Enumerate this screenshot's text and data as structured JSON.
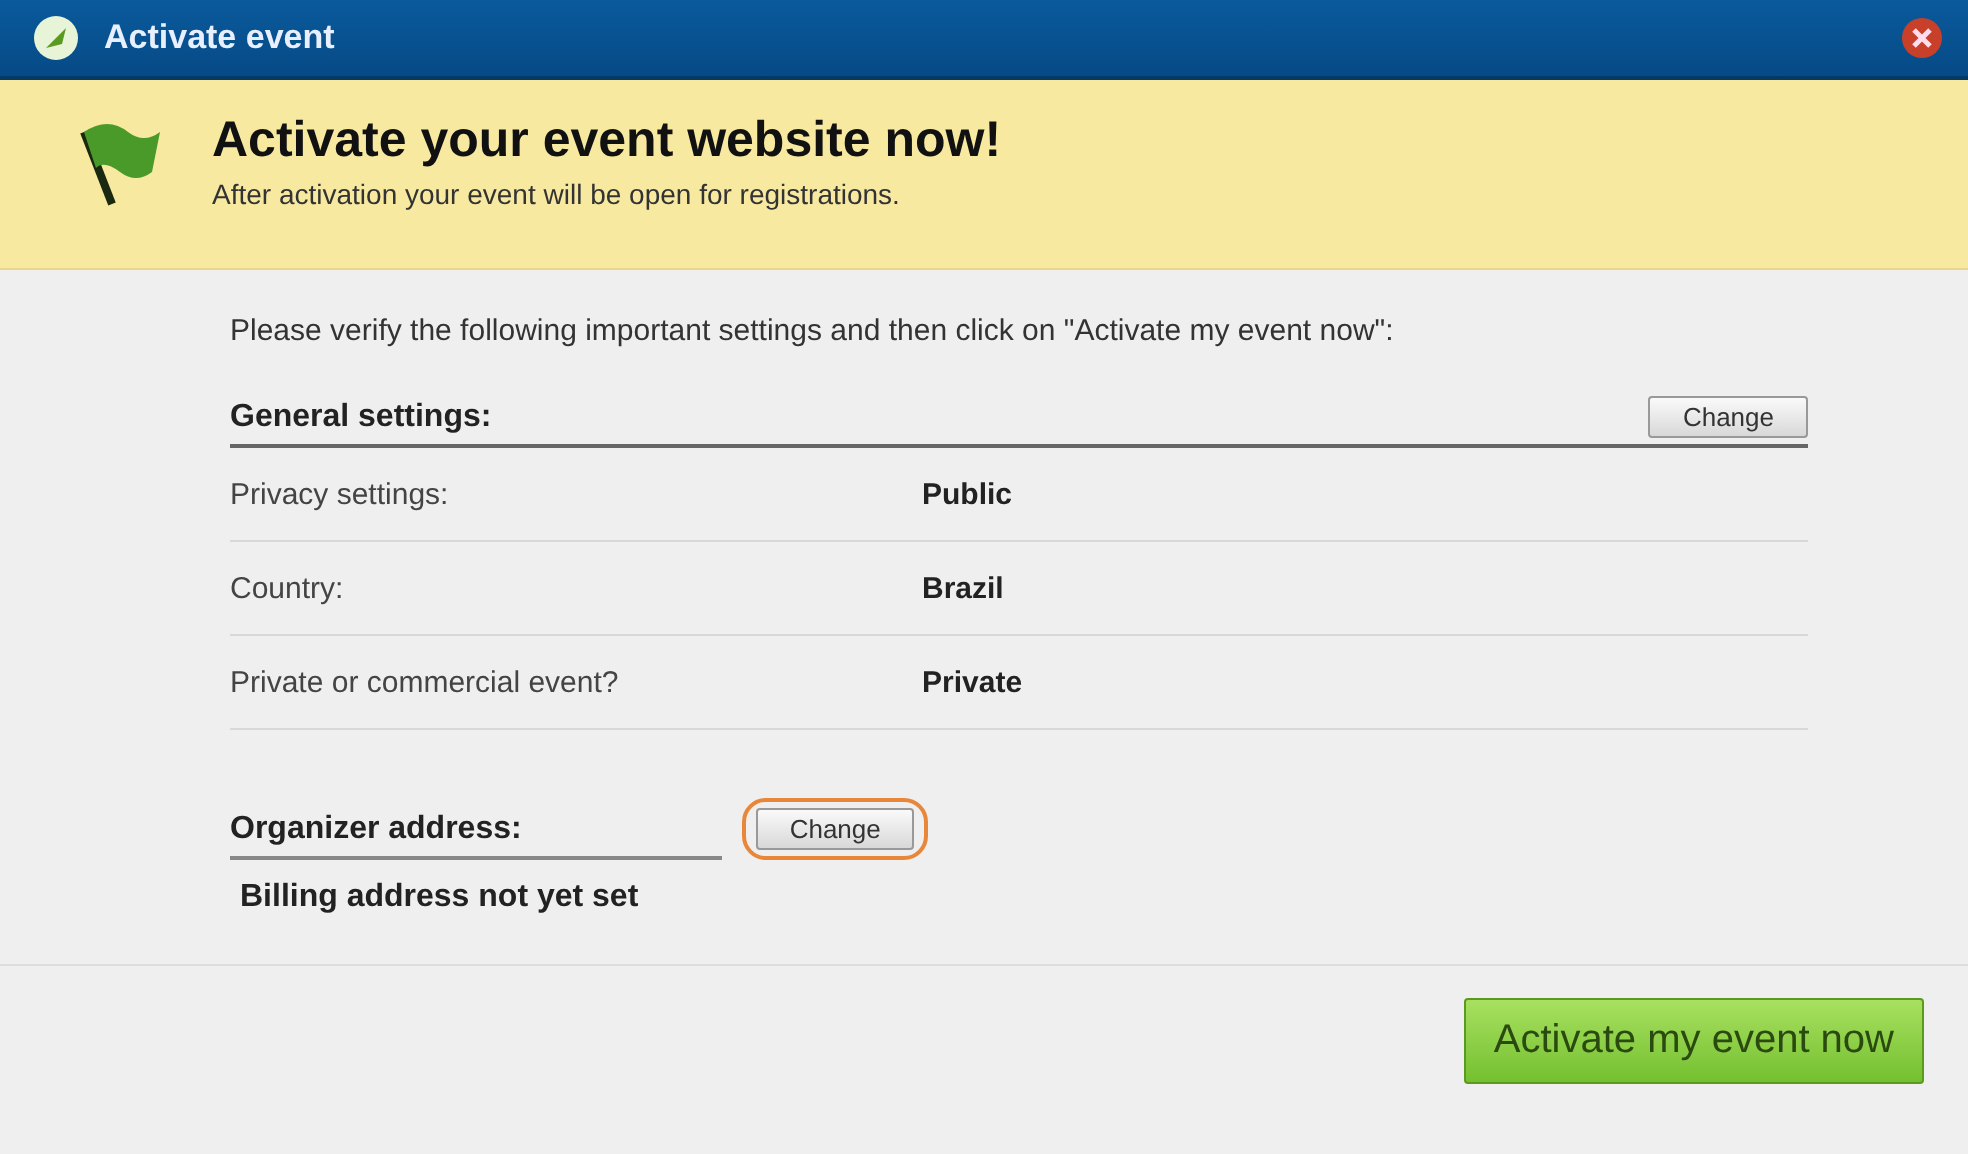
{
  "window": {
    "title": "Activate event"
  },
  "banner": {
    "heading": "Activate your event website now!",
    "subtext": "After activation your event will be open for registrations."
  },
  "intro": "Please verify the following important settings and then click on \"Activate my event now\":",
  "sections": [
    {
      "title": "General settings:",
      "button": {
        "label": "Change",
        "highlighted": false
      },
      "rows": [
        {
          "label": "Privacy settings:",
          "value": "Public"
        },
        {
          "label": "Country:",
          "value": "Brazil"
        },
        {
          "label": "Private or commercial event?",
          "value": "Private"
        }
      ]
    },
    {
      "title": "Organizer address:",
      "button": {
        "label": "Change",
        "highlighted": true
      },
      "note": "Billing address not yet set"
    }
  ],
  "primary_button": "Activate my event now"
}
